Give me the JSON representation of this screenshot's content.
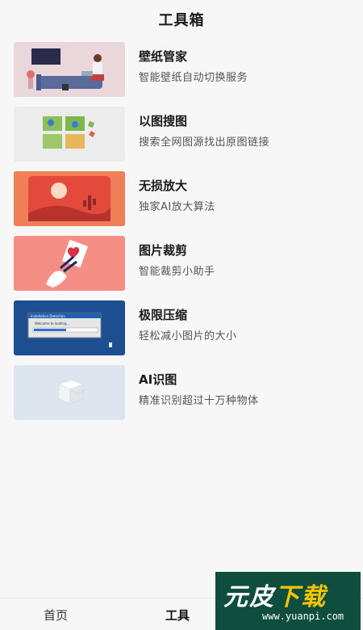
{
  "header": {
    "title": "工具箱"
  },
  "tools": [
    {
      "name": "壁纸管家",
      "desc": "智能壁纸自动切换服务",
      "thumb_color": "#ead7dc"
    },
    {
      "name": "以图搜图",
      "desc": "搜索全网图源找出原图链接",
      "thumb_color": "#ececec"
    },
    {
      "name": "无损放大",
      "desc": "独家AI放大算法",
      "thumb_color": "#ee7f57"
    },
    {
      "name": "图片裁剪",
      "desc": "智能裁剪小助手",
      "thumb_color": "#f58f86"
    },
    {
      "name": "极限压缩",
      "desc": "轻松减小图片的大小",
      "thumb_color": "#1d4e8f"
    },
    {
      "name": "AI识图",
      "desc": "精准识别超过十万种物体",
      "thumb_color": "#dde6ee"
    }
  ],
  "tabbar": {
    "home": "首页",
    "tools": "工具"
  },
  "watermark": {
    "brand_a": "元皮",
    "brand_b": "下载",
    "url": "www.yuanpi.com"
  },
  "dialog_text": {
    "title": "Installation Detection",
    "body": "Welcome to loading..."
  }
}
